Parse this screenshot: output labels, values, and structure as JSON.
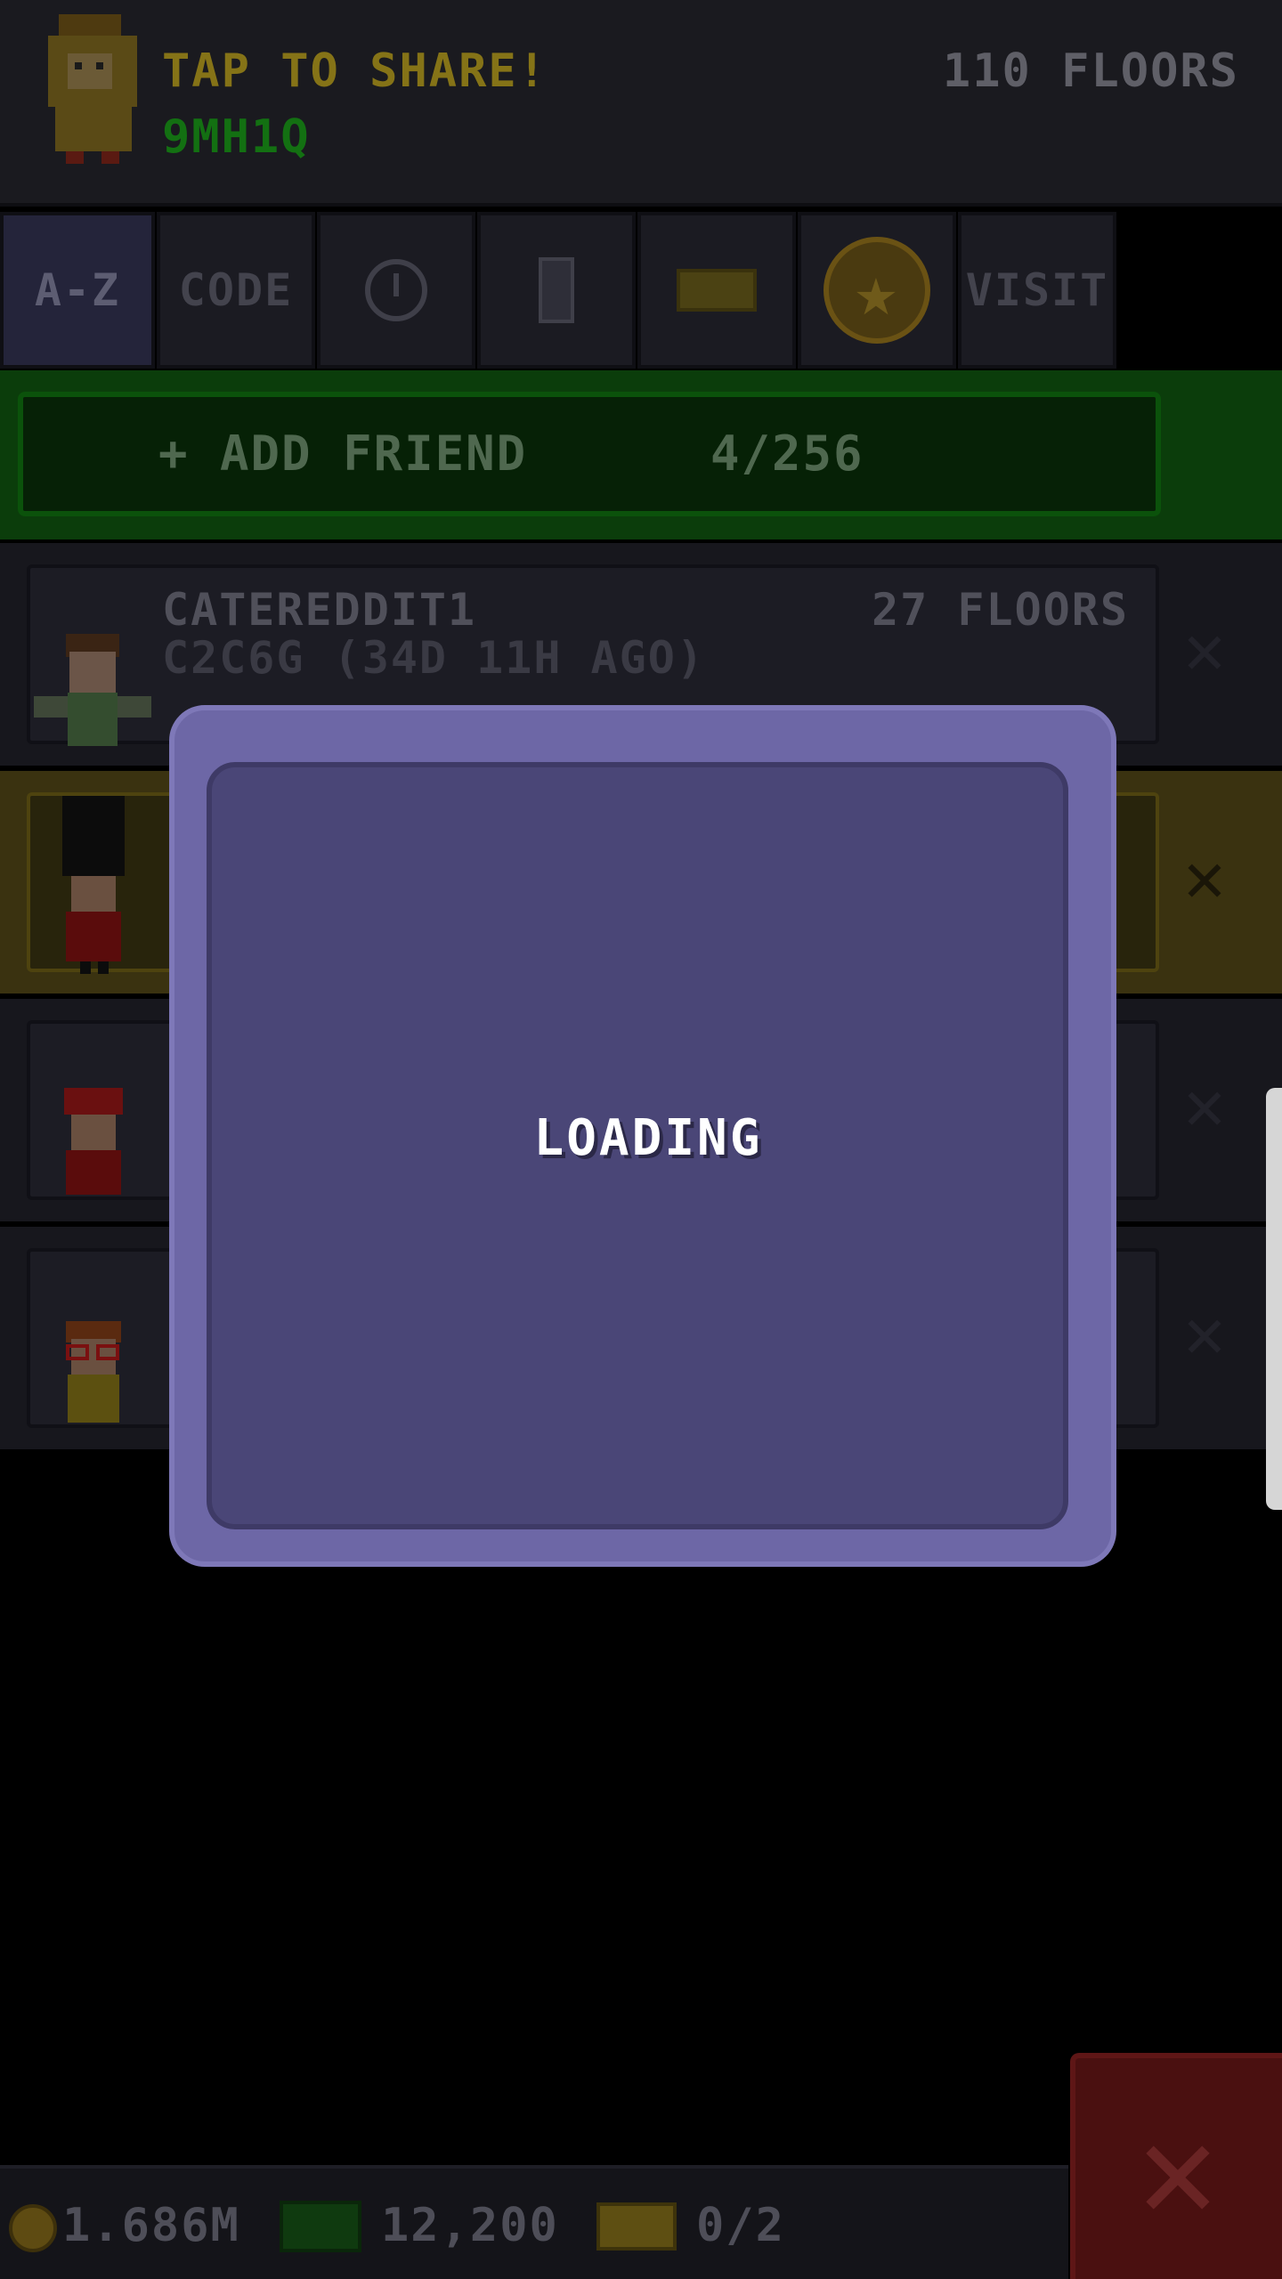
{
  "header": {
    "share_title": "TAP TO SHARE!",
    "share_code": "9MH1Q",
    "floors": "110 FLOORS"
  },
  "tabs": [
    {
      "label": "A-Z",
      "active": true
    },
    {
      "label": "CODE"
    },
    {
      "icon": "clock-icon"
    },
    {
      "icon": "building-icon"
    },
    {
      "icon": "ticket-icon"
    },
    {
      "icon": "star-icon"
    },
    {
      "label": "VISIT"
    }
  ],
  "add_friend": {
    "label": "+ ADD FRIEND",
    "count": "4/256"
  },
  "friends": [
    {
      "name": "CATEREDDIT1",
      "sub": "C2C6G (34D 11H AGO)",
      "floors": "27 FLOORS",
      "remove": "✕"
    },
    {
      "name": "",
      "sub": "",
      "floors": "",
      "remove": "✕",
      "highlight": "gold"
    },
    {
      "name": "",
      "sub": "",
      "floors": "",
      "remove": "✕"
    },
    {
      "name": "",
      "sub": "",
      "floors": "",
      "remove": "✕"
    }
  ],
  "modal": {
    "text": "LOADING"
  },
  "close_button": "✕",
  "status": {
    "coins": "1.686M",
    "bux": "12,200",
    "tickets": "0/2"
  },
  "colors": {
    "modal_outer": "#6d67a6",
    "modal_inner": "#4a4677",
    "add_bar": "#0b3d0b",
    "gold_row": "#3a3210"
  }
}
